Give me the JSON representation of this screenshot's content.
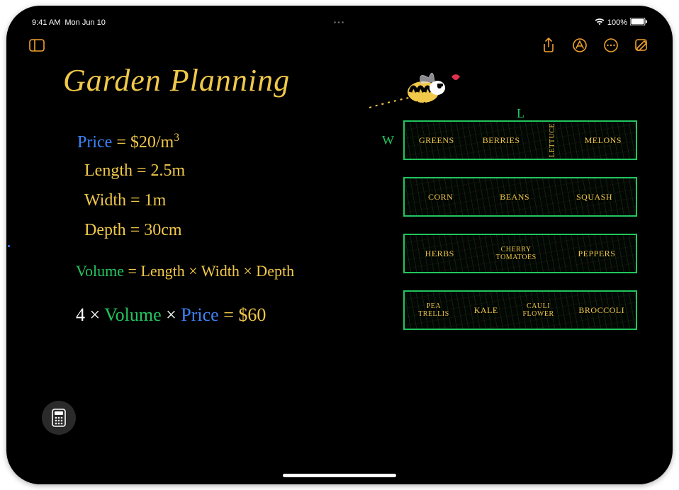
{
  "status": {
    "time": "9:41 AM",
    "date": "Mon Jun 10",
    "battery": "100%"
  },
  "note": {
    "title": "Garden Planning",
    "equations": {
      "price_label": "Price",
      "price_value": "$20/m",
      "price_exp": "3",
      "length_label": "Length",
      "length_value": "2.5m",
      "width_label": "Width",
      "width_value": "1m",
      "depth_label": "Depth",
      "depth_value": "30cm",
      "volume_formula_lhs": "Volume",
      "volume_formula_rhs": "Length × Width × Depth",
      "result_prefix": "4 ×",
      "result_vol": "Volume",
      "result_times": "×",
      "result_price": "Price",
      "result_eq": "= $60"
    },
    "garden": {
      "label_L": "L",
      "label_W": "W",
      "beds": [
        [
          "GREENS",
          "BERRIES",
          "LETTUCE",
          "MELONS"
        ],
        [
          "CORN",
          "BEANS",
          "SQUASH"
        ],
        [
          "HERBS",
          "CHERRY TOMATOES",
          "PEPPERS"
        ],
        [
          "PEA TRELLIS",
          "KALE",
          "CAULI FLOWER",
          "BROCCOLI"
        ]
      ]
    }
  },
  "icons": {
    "sidebar": "sidebar-icon",
    "share": "share-icon",
    "markup": "markup-icon",
    "more": "more-icon",
    "compose": "compose-icon",
    "calculator": "calculator-icon",
    "wifi": "wifi-icon",
    "battery": "battery-icon"
  },
  "colors": {
    "accent": "#f0a030",
    "yellow": "#f0c84a",
    "blue": "#3b82f6",
    "green": "#22c55e"
  }
}
